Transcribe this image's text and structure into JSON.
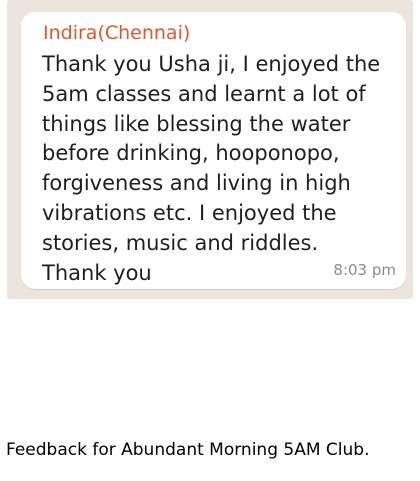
{
  "message": {
    "sender": "Indira(Chennai)",
    "lines": [
      "Thank you Usha ji, I enjoyed the",
      "5am classes and learnt a lot of",
      "things like blessing the water",
      "before drinking, hooponopo,",
      "forgiveness and living in high",
      "vibrations etc. I enjoyed the",
      "stories, music and riddles.",
      "Thank you"
    ],
    "time": "8:03 pm"
  },
  "caption": "Feedback for Abundant Morning 5AM Club.",
  "colors": {
    "sender": "#e4572e",
    "chat_background": "#ece5dd",
    "bubble": "#ffffff",
    "timestamp": "#8c8c8c"
  }
}
